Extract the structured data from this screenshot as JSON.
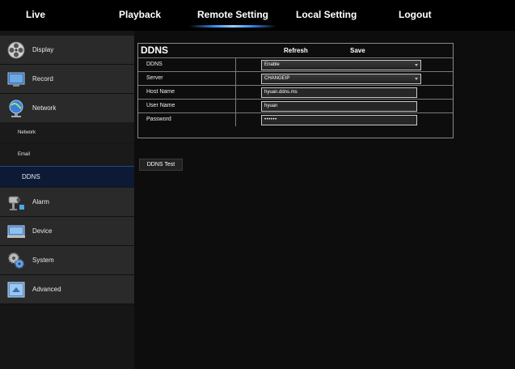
{
  "topnav": {
    "tabs": [
      {
        "label": "Live"
      },
      {
        "label": "Playback"
      },
      {
        "label": "Remote Setting",
        "active": true
      },
      {
        "label": "Local Setting"
      },
      {
        "label": "Logout"
      }
    ]
  },
  "sidebar": {
    "items": [
      {
        "label": "Display",
        "icon": "display-icon"
      },
      {
        "label": "Record",
        "icon": "record-icon"
      },
      {
        "label": "Network",
        "icon": "network-icon"
      },
      {
        "label": "Alarm",
        "icon": "alarm-icon"
      },
      {
        "label": "Device",
        "icon": "device-icon"
      },
      {
        "label": "System",
        "icon": "system-icon"
      },
      {
        "label": "Advanced",
        "icon": "advanced-icon"
      }
    ],
    "network_subitems": [
      {
        "label": "Network"
      },
      {
        "label": "Email"
      },
      {
        "label": "DDNS",
        "selected": true
      }
    ]
  },
  "panel": {
    "title": "DDNS",
    "refresh_label": "Refresh",
    "save_label": "Save",
    "rows": [
      {
        "label": "DDNS",
        "value": "Enable",
        "type": "select"
      },
      {
        "label": "Server",
        "value": "CHANGEIP",
        "type": "select"
      },
      {
        "label": "Host Name",
        "value": "hyuan.ddns.ms",
        "type": "text"
      },
      {
        "label": "User Name",
        "value": "hyuan",
        "type": "text"
      },
      {
        "label": "Password",
        "value": "••••••",
        "type": "password"
      }
    ]
  },
  "ddns_test_label": "DDNS Test",
  "colors": {
    "background": "#000000",
    "sidebar_item": "#2a2a2a",
    "selected_subitem": "#0c1a35",
    "accent_glow": "#3d8ef0"
  }
}
